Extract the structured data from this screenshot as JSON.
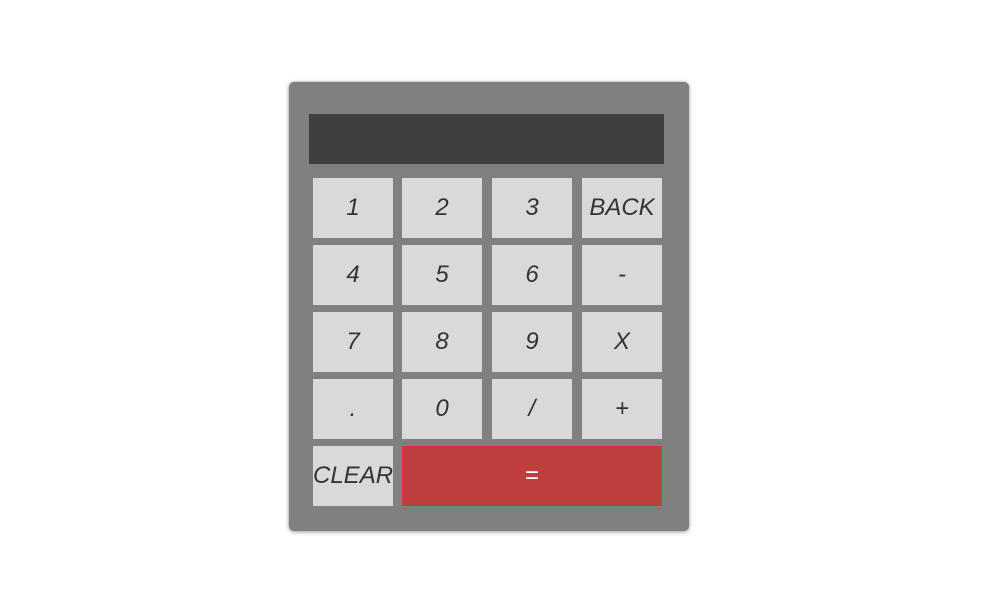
{
  "display": {
    "value": ""
  },
  "keys": {
    "one": "1",
    "two": "2",
    "three": "3",
    "back": "BACK",
    "four": "4",
    "five": "5",
    "six": "6",
    "minus": "-",
    "seven": "7",
    "eight": "8",
    "nine": "9",
    "multiply": "X",
    "decimal": ".",
    "zero": "0",
    "divide": "/",
    "plus": "+",
    "clear": "CLEAR",
    "equals": "="
  },
  "colors": {
    "body": "#808080",
    "display": "#3f3f3f",
    "key": "#d9d9d9",
    "equals": "#bf3f3f"
  }
}
